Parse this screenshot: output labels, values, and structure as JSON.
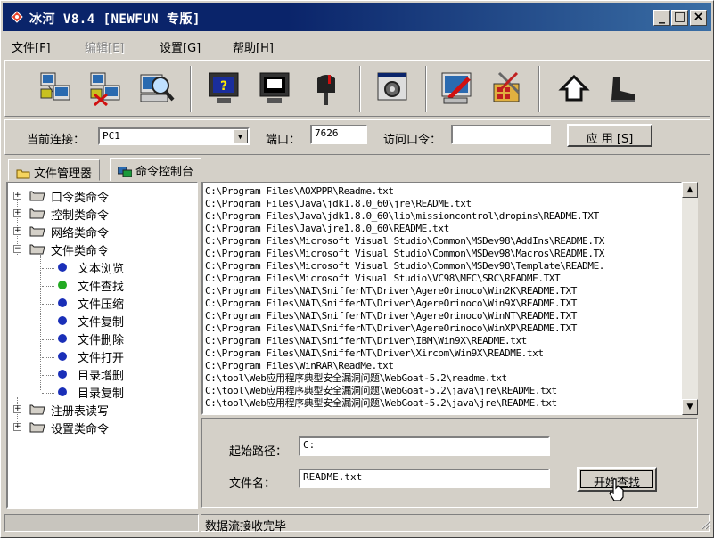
{
  "window": {
    "title": "冰河 V8.4 [NEWFUN 专版]",
    "controls": {
      "minimize": "_",
      "maximize": "□",
      "close": "×"
    }
  },
  "menu": [
    {
      "label": "文件[F]",
      "enabled": true
    },
    {
      "label": "编辑[E]",
      "enabled": false
    },
    {
      "label": "设置[G]",
      "enabled": true
    },
    {
      "label": "帮助[H]",
      "enabled": true
    }
  ],
  "toolbar": {
    "icons": [
      "add-host-icon",
      "delete-host-icon",
      "search-host-icon",
      "screen-capture-icon",
      "screen-control-icon",
      "mail-icon",
      "config-icon",
      "edit-icon",
      "tools-icon",
      "home-icon",
      "boot-icon"
    ]
  },
  "connection": {
    "current_label": "当前连接：",
    "current_value": "PC1",
    "port_label": "端口：",
    "port_value": "7626",
    "password_label": "访问口令：",
    "password_value": "",
    "apply_label": "应 用 [S]"
  },
  "tabs": [
    {
      "label": "文件管理器",
      "active": false
    },
    {
      "label": "命令控制台",
      "active": true
    }
  ],
  "tree": {
    "categories": [
      {
        "label": "口令类命令",
        "expanded": false
      },
      {
        "label": "控制类命令",
        "expanded": false
      },
      {
        "label": "网络类命令",
        "expanded": false
      },
      {
        "label": "文件类命令",
        "expanded": true
      },
      {
        "label": "注册表读写",
        "expanded": false
      },
      {
        "label": "设置类命令",
        "expanded": false
      }
    ],
    "file_commands": [
      {
        "label": "文本浏览",
        "selected": false
      },
      {
        "label": "文件查找",
        "selected": true
      },
      {
        "label": "文件压缩",
        "selected": false
      },
      {
        "label": "文件复制",
        "selected": false
      },
      {
        "label": "文件删除",
        "selected": false
      },
      {
        "label": "文件打开",
        "selected": false
      },
      {
        "label": "目录增删",
        "selected": false
      },
      {
        "label": "目录复制",
        "selected": false
      }
    ]
  },
  "results": [
    "C:\\Program Files\\AOXPPR\\Readme.txt",
    "C:\\Program Files\\Java\\jdk1.8.0_60\\jre\\README.txt",
    "C:\\Program Files\\Java\\jdk1.8.0_60\\lib\\missioncontrol\\dropins\\README.TXT",
    "C:\\Program Files\\Java\\jre1.8.0_60\\README.txt",
    "C:\\Program Files\\Microsoft Visual Studio\\Common\\MSDev98\\AddIns\\README.TX",
    "C:\\Program Files\\Microsoft Visual Studio\\Common\\MSDev98\\Macros\\README.TX",
    "C:\\Program Files\\Microsoft Visual Studio\\Common\\MSDev98\\Template\\README.",
    "C:\\Program Files\\Microsoft Visual Studio\\VC98\\MFC\\SRC\\README.TXT",
    "C:\\Program Files\\NAI\\SnifferNT\\Driver\\AgereOrinoco\\Win2K\\README.TXT",
    "C:\\Program Files\\NAI\\SnifferNT\\Driver\\AgereOrinoco\\Win9X\\README.TXT",
    "C:\\Program Files\\NAI\\SnifferNT\\Driver\\AgereOrinoco\\WinNT\\README.TXT",
    "C:\\Program Files\\NAI\\SnifferNT\\Driver\\AgereOrinoco\\WinXP\\README.TXT",
    "C:\\Program Files\\NAI\\SnifferNT\\Driver\\IBM\\Win9X\\README.txt",
    "C:\\Program Files\\NAI\\SnifferNT\\Driver\\Xircom\\Win9X\\README.txt",
    "C:\\Program Files\\WinRAR\\ReadMe.txt",
    "C:\\tool\\Web应用程序典型安全漏洞问题\\WebGoat-5.2\\readme.txt",
    "C:\\tool\\Web应用程序典型安全漏洞问题\\WebGoat-5.2\\java\\jre\\README.txt",
    "C:\\tool\\Web应用程序典型安全漏洞问题\\WebGoat-5.2\\java\\jre\\README.txt"
  ],
  "search": {
    "start_path_label": "起始路径：",
    "start_path_value": "C:",
    "file_name_label": "文件名：",
    "file_name_value": "README.txt",
    "start_button_label": "开始查找"
  },
  "status": {
    "message": "数据流接收完毕"
  },
  "colors": {
    "titlebar": "#0a246a",
    "face": "#d4d0c8",
    "selected_dot": "#22aa22",
    "normal_dot": "#1a2fb8"
  }
}
